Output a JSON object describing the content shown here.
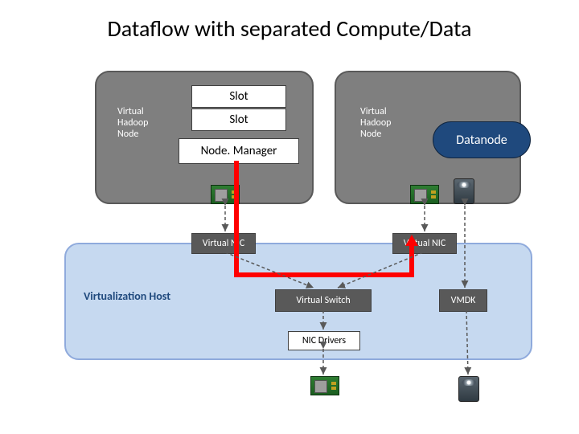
{
  "title": "Dataflow with separated Compute/Data",
  "vm": {
    "left_label1": "Virtual",
    "left_label2": "Hadoop",
    "left_label3": "Node",
    "right_label1": "Virtual",
    "right_label2": "Hadoop",
    "right_label3": "Node"
  },
  "slots": {
    "slot1": "Slot",
    "slot2": "Slot"
  },
  "nodemanager": "Node. Manager",
  "datanode": "Datanode",
  "vnic": {
    "left": "Virtual NIC",
    "right": "Virtual NIC"
  },
  "vswitch": "Virtual Switch",
  "nic_drivers": "NIC Drivers",
  "vmdk": "VMDK",
  "vhost_label": "Virtualization Host",
  "colors": {
    "vm_gray": "#7f7f7f",
    "host_blue": "#c6d9f0",
    "datanode_blue": "#1f497d",
    "box_dark": "#595959",
    "flow_red": "#ff0000"
  }
}
